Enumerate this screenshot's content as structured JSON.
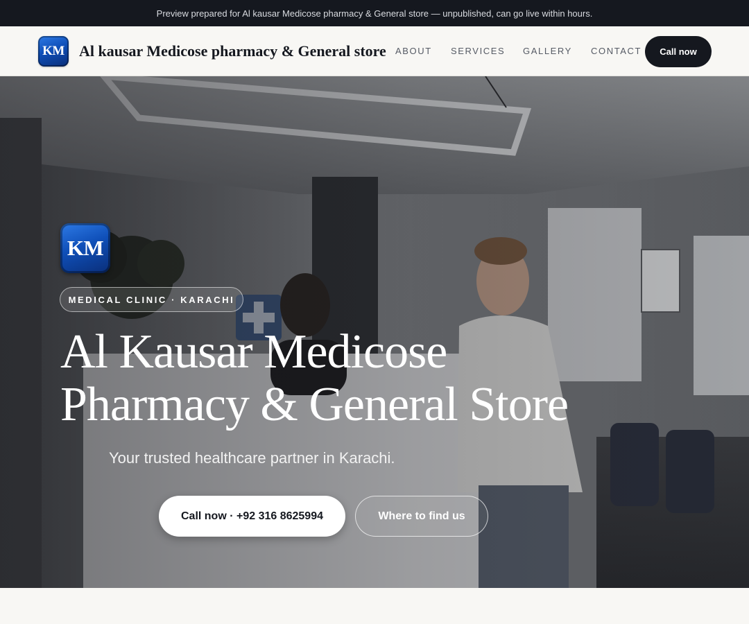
{
  "banner": {
    "text": "Preview prepared for Al kausar Medicose pharmacy & General store — unpublished, can go live within hours."
  },
  "nav": {
    "logo_initials": "KM",
    "brand": "Al kausar Medicose pharmacy & General store",
    "links": [
      "ABOUT",
      "SERVICES",
      "GALLERY",
      "CONTACT"
    ],
    "cta": "Call now"
  },
  "hero": {
    "logo_initials": "KM",
    "category": "MEDICAL CLINIC · KARACHI",
    "title_lines": [
      "Al Kausar Medicose",
      "Pharmacy & General Store"
    ],
    "tagline": "Your trusted healthcare partner in Karachi.",
    "primary_button": "Call now · +92 316 8625994",
    "secondary_button": "Where to find us",
    "photo_icon": "pharmacy-reception-photo"
  },
  "colors": {
    "dark": "#15181f",
    "background": "#f8f7f4",
    "badge_blue": "#0f4fb8",
    "white": "#ffffff"
  }
}
